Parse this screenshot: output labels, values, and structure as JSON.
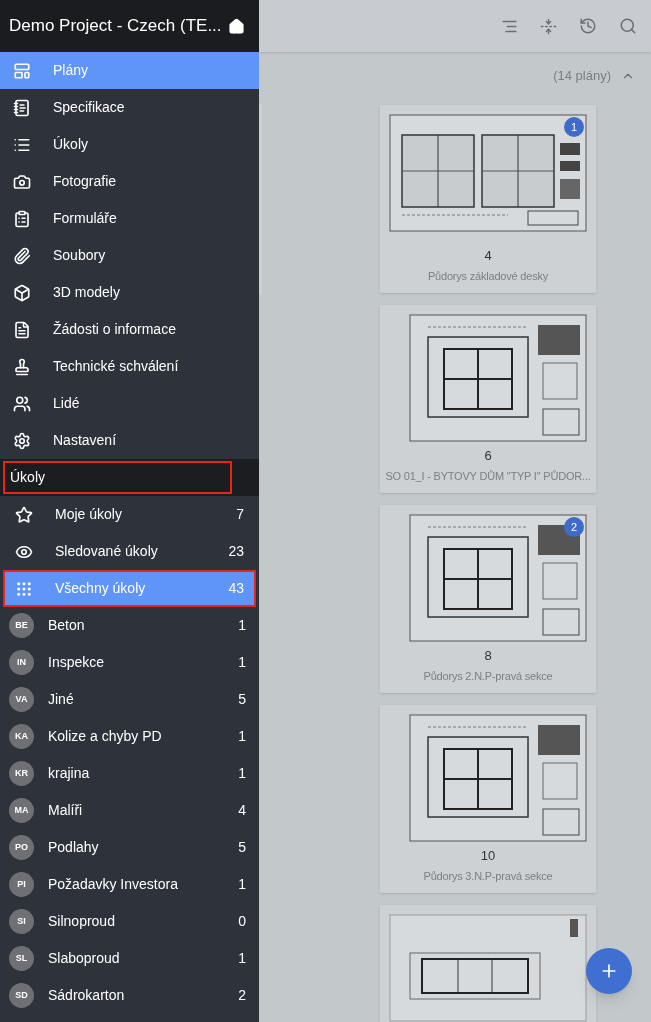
{
  "header": {
    "title": "Demo Project - Czech (TE..."
  },
  "nav_items": [
    {
      "label": "Plány",
      "kind": "plans",
      "selected": true
    },
    {
      "label": "Specifikace",
      "kind": "notebook",
      "selected": false
    },
    {
      "label": "Úkoly",
      "kind": "list",
      "selected": false
    },
    {
      "label": "Fotografie",
      "kind": "camera",
      "selected": false
    },
    {
      "label": "Formuláře",
      "kind": "clipboard",
      "selected": false
    },
    {
      "label": "Soubory",
      "kind": "paperclip",
      "selected": false
    },
    {
      "label": "3D modely",
      "kind": "cube",
      "selected": false
    },
    {
      "label": "Žádosti o informace",
      "kind": "info",
      "selected": false
    },
    {
      "label": "Technické schválení",
      "kind": "stamp",
      "selected": false
    },
    {
      "label": "Lidé",
      "kind": "people",
      "selected": false
    },
    {
      "label": "Nastavení",
      "kind": "gear",
      "selected": false
    }
  ],
  "section": {
    "title": "Úkoly",
    "highlighted": true
  },
  "task_filters": [
    {
      "label": "Moje úkoly",
      "kind": "star",
      "count": "7",
      "selected": false,
      "highlighted": false
    },
    {
      "label": "Sledované úkoly",
      "kind": "eye",
      "count": "23",
      "selected": false,
      "highlighted": false
    },
    {
      "label": "Všechny úkoly",
      "kind": "grid",
      "count": "43",
      "selected": true,
      "highlighted": true
    }
  ],
  "categories": [
    {
      "initials": "BE",
      "label": "Beton",
      "count": "1"
    },
    {
      "initials": "IN",
      "label": "Inspekce",
      "count": "1"
    },
    {
      "initials": "VA",
      "label": "Jiné",
      "count": "5"
    },
    {
      "initials": "KA",
      "label": "Kolize a chyby PD",
      "count": "1"
    },
    {
      "initials": "KR",
      "label": "krajina",
      "count": "1"
    },
    {
      "initials": "MA",
      "label": "Malíři",
      "count": "4"
    },
    {
      "initials": "PO",
      "label": "Podlahy",
      "count": "5"
    },
    {
      "initials": "PI",
      "label": "Požadavky Investora",
      "count": "1"
    },
    {
      "initials": "SI",
      "label": "Silnoproud",
      "count": "0"
    },
    {
      "initials": "SL",
      "label": "Slaboproud",
      "count": "1"
    },
    {
      "initials": "SD",
      "label": "Sádrokarton",
      "count": "2"
    }
  ],
  "plans_summary": {
    "count_label": "(14 plány)",
    "expanded": true
  },
  "plans": [
    {
      "kind": "double",
      "number": "4",
      "title": "Půdorys základové desky",
      "badge": "1"
    },
    {
      "kind": "single",
      "number": "6",
      "title": "SO 01_I - BYTOVY DŮM \"TYP I\" PŮDOR..."
    },
    {
      "kind": "single",
      "number": "8",
      "title": "Půdorys 2.N.P-pravá sekce",
      "badge": "2"
    },
    {
      "kind": "single",
      "number": "10",
      "title": "Půdorys 3.N.P-pravá sekce"
    },
    {
      "kind": "wide"
    }
  ]
}
